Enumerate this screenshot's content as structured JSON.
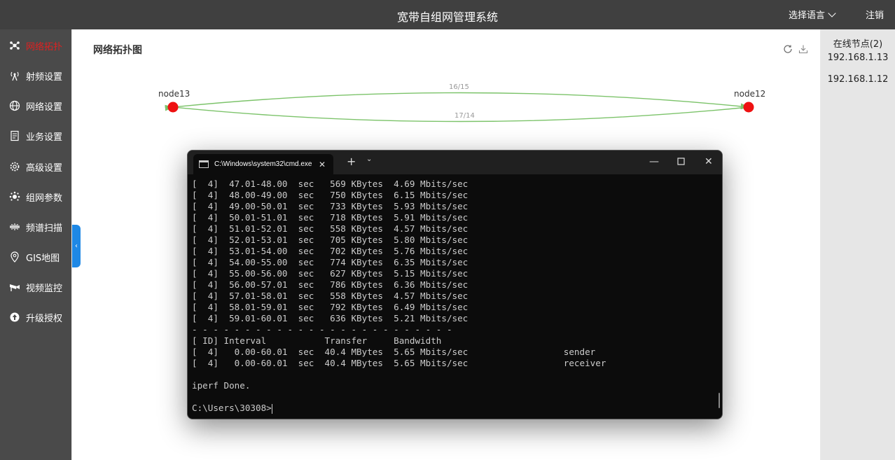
{
  "header": {
    "title": "宽带自组网管理系统",
    "language_label": "选择语言",
    "logout_label": "注销"
  },
  "sidebar": {
    "items": [
      {
        "label": "网络拓扑",
        "icon": "topology-icon",
        "active": true
      },
      {
        "label": "射频设置",
        "icon": "antenna-icon"
      },
      {
        "label": "网络设置",
        "icon": "globe-icon"
      },
      {
        "label": "业务设置",
        "icon": "document-icon"
      },
      {
        "label": "高级设置",
        "icon": "gear-icon"
      },
      {
        "label": "组网参数",
        "icon": "network-params-icon"
      },
      {
        "label": "频谱扫描",
        "icon": "spectrum-icon"
      },
      {
        "label": "GIS地图",
        "icon": "map-pin-icon"
      },
      {
        "label": "视频监控",
        "icon": "camera-icon"
      },
      {
        "label": "升级授权",
        "icon": "upgrade-icon"
      }
    ]
  },
  "main": {
    "title": "网络拓扑图",
    "topology": {
      "nodes": [
        {
          "name": "node13"
        },
        {
          "name": "node12"
        }
      ],
      "links": [
        {
          "label": "16/15"
        },
        {
          "label": "17/14"
        }
      ],
      "node_color": "#ee1111",
      "link_color": "#7cc36a"
    }
  },
  "right_panel": {
    "title": "在线节点(2)",
    "nodes": [
      "192.168.1.13",
      "192.168.1.12"
    ]
  },
  "cmd_window": {
    "tab_title": "C:\\Windows\\system32\\cmd.exe",
    "lines": [
      "[  4]  47.01-48.00  sec   569 KBytes  4.69 Mbits/sec",
      "[  4]  48.00-49.00  sec   750 KBytes  6.15 Mbits/sec",
      "[  4]  49.00-50.01  sec   733 KBytes  5.93 Mbits/sec",
      "[  4]  50.01-51.01  sec   718 KBytes  5.91 Mbits/sec",
      "[  4]  51.01-52.01  sec   558 KBytes  4.57 Mbits/sec",
      "[  4]  52.01-53.01  sec   705 KBytes  5.80 Mbits/sec",
      "[  4]  53.01-54.00  sec   702 KBytes  5.76 Mbits/sec",
      "[  4]  54.00-55.00  sec   774 KBytes  6.35 Mbits/sec",
      "[  4]  55.00-56.00  sec   627 KBytes  5.15 Mbits/sec",
      "[  4]  56.00-57.01  sec   786 KBytes  6.36 Mbits/sec",
      "[  4]  57.01-58.01  sec   558 KBytes  4.57 Mbits/sec",
      "[  4]  58.01-59.01  sec   792 KBytes  6.49 Mbits/sec",
      "[  4]  59.01-60.01  sec   636 KBytes  5.21 Mbits/sec",
      "- - - - - - - - - - - - - - - - - - - - - - - - -",
      "[ ID] Interval           Transfer     Bandwidth",
      "[  4]   0.00-60.01  sec  40.4 MBytes  5.65 Mbits/sec                  sender",
      "[  4]   0.00-60.01  sec  40.4 MBytes  5.65 Mbits/sec                  receiver",
      "",
      "iperf Done.",
      ""
    ],
    "prompt": "C:\\Users\\30308>"
  }
}
